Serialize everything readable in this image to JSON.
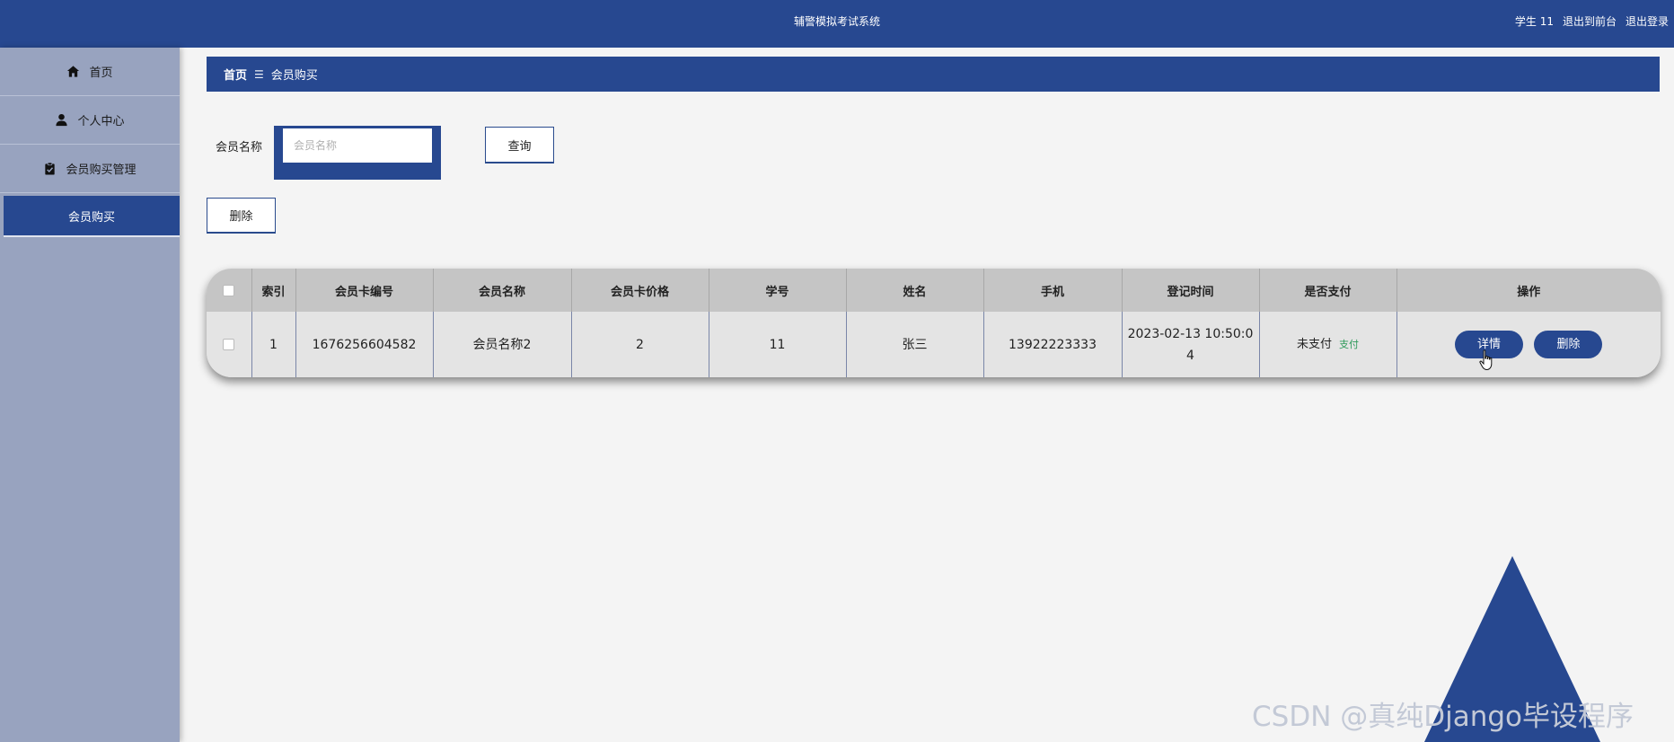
{
  "app": {
    "title": "辅警模拟考试系统",
    "user_label": "学生 11",
    "exit_front_label": "退出到前台",
    "logout_label": "退出登录"
  },
  "sidebar": {
    "items": [
      {
        "label": "首页",
        "icon": "home-icon"
      },
      {
        "label": "个人中心",
        "icon": "user-icon"
      },
      {
        "label": "会员购买管理",
        "icon": "clipboard-icon"
      }
    ],
    "subitem": {
      "label": "会员购买",
      "active": true
    }
  },
  "breadcrumb": {
    "home": "首页",
    "separator": "☰",
    "current": "会员购买"
  },
  "search": {
    "label": "会员名称",
    "placeholder": "会员名称",
    "value": "",
    "button_label": "查询"
  },
  "toolbar": {
    "delete_label": "删除"
  },
  "table": {
    "columns": [
      "索引",
      "会员卡编号",
      "会员名称",
      "会员卡价格",
      "学号",
      "姓名",
      "手机",
      "登记时间",
      "是否支付",
      "操作"
    ],
    "rows": [
      {
        "index": "1",
        "card_no": "1676256604582",
        "member_name": "会员名称2",
        "price": "2",
        "student_no": "11",
        "name": "张三",
        "phone": "13922223333",
        "reg_time_line1": "2023-02-13 10:50:0",
        "reg_time_line2": "4",
        "pay_status": "未支付",
        "pay_action": "支付",
        "detail_label": "详情",
        "delete_label": "删除"
      }
    ]
  },
  "watermark": "CSDN @真纯Django毕设程序",
  "colors": {
    "primary": "#274890",
    "sidebar_bg": "#98a3bf",
    "page_bg": "#f4f4f4",
    "table_header_bg": "#c5c5c5",
    "table_row_bg": "#e4e4e4",
    "pay_link": "#2e9a5a"
  }
}
